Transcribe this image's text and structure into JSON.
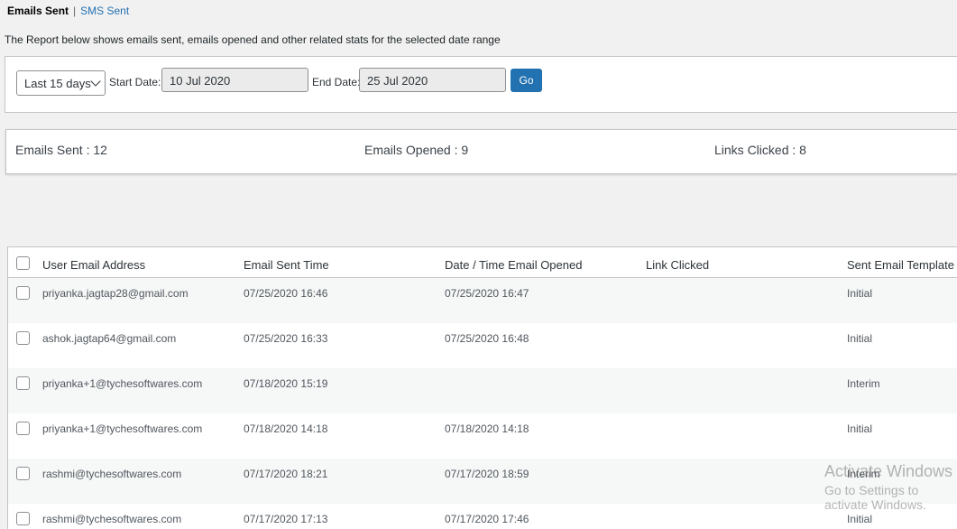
{
  "subnav": {
    "current": "Emails Sent",
    "separator": "|",
    "other": "SMS Sent"
  },
  "description": "The Report below shows emails sent, emails opened and other related stats for the selected date range",
  "filter": {
    "range_selected": "Last 15 days",
    "start_label": "Start Date:",
    "start_value": "10 Jul 2020",
    "end_label": "End Date:",
    "end_value": "25 Jul 2020",
    "go_label": "Go"
  },
  "stats": {
    "sent": "Emails Sent : 12",
    "opened": "Emails Opened : 9",
    "clicked": "Links Clicked : 8"
  },
  "table": {
    "columns": [
      "User Email Address",
      "Email Sent Time",
      "Date / Time Email Opened",
      "Link Clicked",
      "Sent Email Template"
    ],
    "rows": [
      {
        "email": "priyanka.jagtap28@gmail.com",
        "sent": "07/25/2020 16:46",
        "opened": "07/25/2020 16:47",
        "link": "",
        "template": "Initial"
      },
      {
        "email": "ashok.jagtap64@gmail.com",
        "sent": "07/25/2020 16:33",
        "opened": "07/25/2020 16:48",
        "link": "",
        "template": "Initial"
      },
      {
        "email": "priyanka+1@tychesoftwares.com",
        "sent": "07/18/2020 15:19",
        "opened": "",
        "link": "",
        "template": "Interim"
      },
      {
        "email": "priyanka+1@tychesoftwares.com",
        "sent": "07/18/2020 14:18",
        "opened": "07/18/2020 14:18",
        "link": "",
        "template": "Initial"
      },
      {
        "email": "rashmi@tychesoftwares.com",
        "sent": "07/17/2020 18:21",
        "opened": "07/17/2020 18:59",
        "link": "",
        "template": "Interim"
      },
      {
        "email": "rashmi@tychesoftwares.com",
        "sent": "07/17/2020 17:13",
        "opened": "07/17/2020 17:46",
        "link": "",
        "template": "Initial"
      }
    ]
  },
  "watermark": {
    "line1": "Activate Windows",
    "line2": "Go to Settings to activate Windows."
  },
  "colors": {
    "link": "#2271b1",
    "button": "#2271b1",
    "background": "#f1f1f1"
  }
}
